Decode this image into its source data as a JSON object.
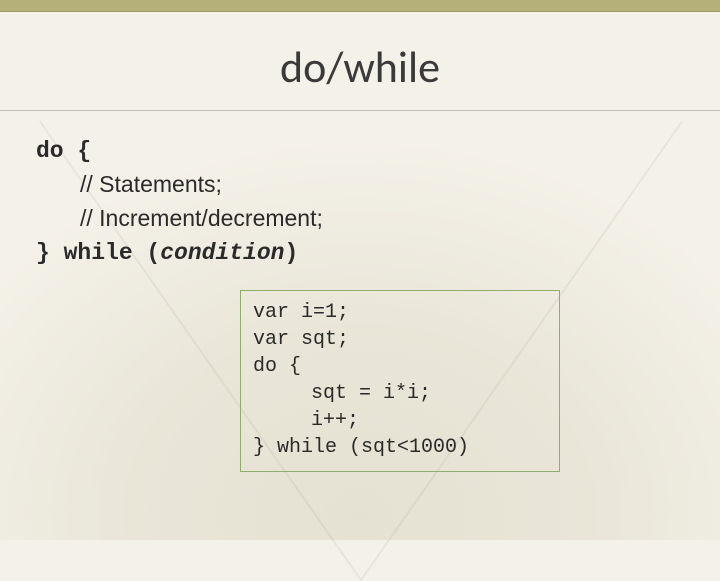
{
  "title": "do/while",
  "syntax": {
    "line1_keyword": "do",
    "line1_brace": " {",
    "line2": "// Statements;",
    "line3": "// Increment/decrement;",
    "line4_close": "} ",
    "line4_keyword": "while (",
    "line4_condition": "condition",
    "line4_end": ")"
  },
  "example": {
    "l1": "var i=1;",
    "l2": "var sqt;",
    "l3": "do {",
    "l4": "sqt = i*i;",
    "l5": "i++;",
    "l6": "} while (sqt<1000)"
  }
}
